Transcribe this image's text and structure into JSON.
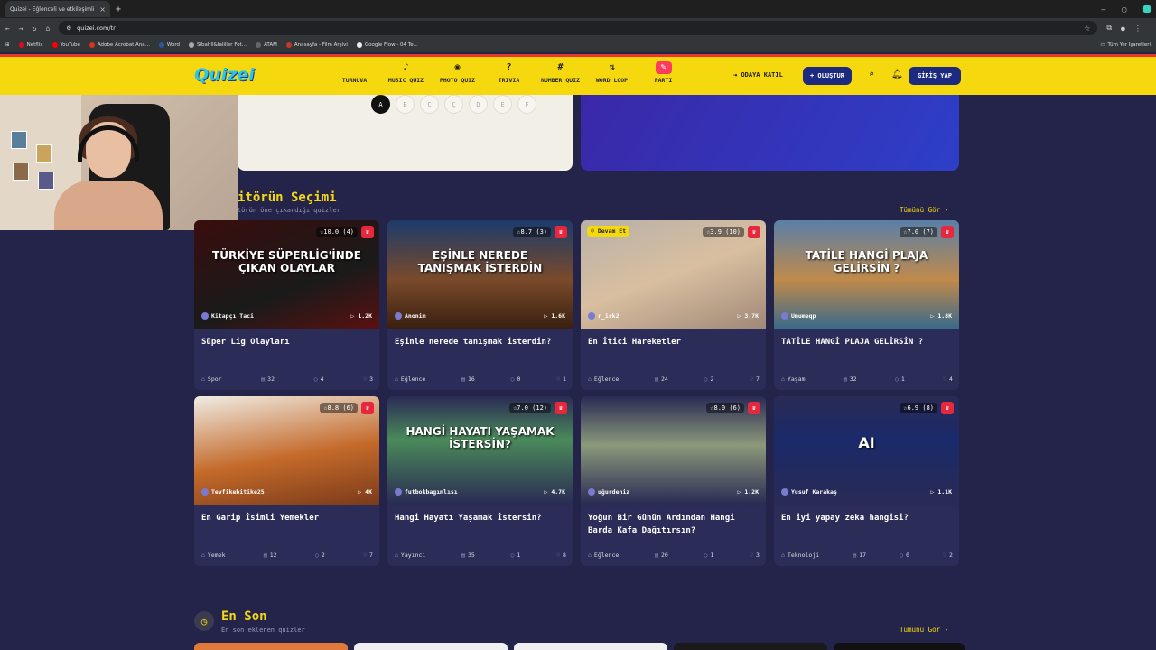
{
  "browser": {
    "tab_title": "Quizei - Eğlenceli ve etkileşimli",
    "url": "quizei.com/tr",
    "bookmarks": [
      "Netflix",
      "YouTube",
      "Adobe Acrobat Ana...",
      "Word",
      "Sibahİl&Ialiller Fot...",
      "ATAM",
      "Anasayfa - Film Arşivi",
      "Google Flow - 04 Te..."
    ],
    "bookmarks_right": "Tüm Yer İşaretleri"
  },
  "nav": {
    "logo": "Quizei",
    "items": [
      {
        "label": "TURNUVA",
        "icon": ""
      },
      {
        "label": "MUSIC QUIZ",
        "icon": "♪"
      },
      {
        "label": "PHOTO QUIZ",
        "icon": "◉"
      },
      {
        "label": "TRIVIA",
        "icon": "?"
      },
      {
        "label": "NUMBER QUIZ",
        "icon": "#"
      },
      {
        "label": "WORD LOOP",
        "icon": "⇅"
      },
      {
        "label": "PARTI",
        "icon": "✎"
      }
    ],
    "join": "ODAYA KATIL",
    "create": "+ OLUŞTUR",
    "login": "GİRİŞ YAP"
  },
  "letters": [
    "A",
    "B",
    "C",
    "Ç",
    "D",
    "E",
    "F"
  ],
  "editors": {
    "title": "itörün Seçimi",
    "subtitle": "törün öne çıkardığı quizler",
    "see_all": "Tümünü Gör ›"
  },
  "cards": [
    {
      "rating": "☆10.0 (4)",
      "thumb_text": "TÜRKİYE SÜPERLİG'İNDE ÇIKAN OLAYLAR",
      "author": "Kitapçı Taci",
      "plays": "▷ 1.2K",
      "title": "Süper Lig Olayları",
      "category": "Spor",
      "questions": "32",
      "comments": "4",
      "likes": "3",
      "bg": "linear-gradient(160deg,#3a0d0d,#1a1a1a 60%,#5a1010)"
    },
    {
      "rating": "☆8.7 (3)",
      "thumb_text": "EŞİNLE NEREDE TANIŞMAK İSTERDİN",
      "author": "Anonim",
      "plays": "▷ 1.6K",
      "title": "Eşinle nerede tanışmak isterdin?",
      "category": "Eğlence",
      "questions": "16",
      "comments": "0",
      "likes": "1",
      "bg": "linear-gradient(180deg,#1c3b6a,#7a4a2a 55%,#3a2010)"
    },
    {
      "badge": "☺ Devam Et",
      "rating": "☆3.9 (10)",
      "thumb_text": "",
      "author": "r_irk2",
      "plays": "▷ 3.7K",
      "title": "En İtici Hareketler",
      "category": "Eğlence",
      "questions": "24",
      "comments": "2",
      "likes": "7",
      "bg": "linear-gradient(160deg,#b8b0a8,#d9bfa0 50%,#a08878)"
    },
    {
      "rating": "☆7.0 (7)",
      "thumb_text": "TATİLE HANGİ PLAJA GELİRSİN ?",
      "author": "Umumeqp",
      "plays": "▷ 1.8K",
      "title": "TATİLE HANGİ PLAJA GELİRSİN ?",
      "category": "Yaşam",
      "questions": "32",
      "comments": "1",
      "likes": "4",
      "bg": "linear-gradient(180deg,#5a7fa8,#c08a4a 55%,#3a6a8a)"
    },
    {
      "rating": "☆8.8 (6)",
      "thumb_text": "",
      "author": "Tevfikebitike25",
      "plays": "▷ 4K",
      "title": "En Garip İsimli Yemekler",
      "category": "Yemek",
      "questions": "12",
      "comments": "2",
      "likes": "7",
      "bg": "linear-gradient(170deg,#f0ece4,#c46a2a 55%,#7a3a1a)"
    },
    {
      "rating": "☆7.0 (12)",
      "thumb_text": "HANGİ HAYATI YAŞAMAK İSTERSİN?",
      "author": "futbokbagımlısı",
      "plays": "▷ 4.7K",
      "title": "Hangi Hayatı Yaşamak İstersin?",
      "category": "Yayıncı",
      "questions": "35",
      "comments": "1",
      "likes": "8",
      "bg": "linear-gradient(180deg,#2a2a54,#4a8a5a 40%,#2a2a54)"
    },
    {
      "rating": "☆8.0 (6)",
      "thumb_text": "",
      "author": "uğurdeniz",
      "plays": "▷ 1.2K",
      "title": "Yoğun Bir Günün Ardından Hangi Barda Kafa Dağıtırsın?",
      "category": "Eğlence",
      "questions": "20",
      "comments": "1",
      "likes": "3",
      "bg": "linear-gradient(180deg,#2a2a54,#8a9a7a 45%,#2a2a54)"
    },
    {
      "rating": "☆6.9 (8)",
      "thumb_text": "AI",
      "author": "Yusuf Karakaş",
      "plays": "▷ 1.1K",
      "title": "En iyi yapay zeka hangisi?",
      "category": "Teknoloji",
      "questions": "17",
      "comments": "0",
      "likes": "2",
      "bg": "linear-gradient(180deg,#2a2a54,#1a2a6a 40%,#2a2a54)"
    }
  ],
  "latest": {
    "title": "En Son",
    "subtitle": "En son eklenen quizler",
    "see_all": "Tümünü Gör ›"
  }
}
